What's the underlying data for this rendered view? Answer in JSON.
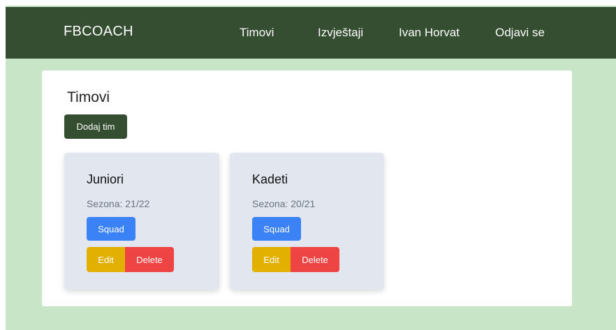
{
  "navbar": {
    "brand": "FBCOACH",
    "items": [
      {
        "label": "Timovi"
      },
      {
        "label": "Izvještaji"
      },
      {
        "label": "Ivan Horvat"
      },
      {
        "label": "Odjavi se"
      }
    ]
  },
  "main": {
    "title": "Timovi",
    "add_button_label": "Dodaj tim",
    "teams": [
      {
        "name": "Juniori",
        "season": "Sezona: 21/22",
        "squad_label": "Squad",
        "edit_label": "Edit",
        "delete_label": "Delete"
      },
      {
        "name": "Kadeti",
        "season": "Sezona: 20/21",
        "squad_label": "Squad",
        "edit_label": "Edit",
        "delete_label": "Delete"
      }
    ]
  },
  "colors": {
    "navbar_bg": "#354e31",
    "page_bg": "#c9e5c7",
    "card_bg": "#e1e6ef",
    "squad_button": "#3b82f6",
    "edit_button": "#e2b000",
    "delete_button": "#ef4444"
  }
}
